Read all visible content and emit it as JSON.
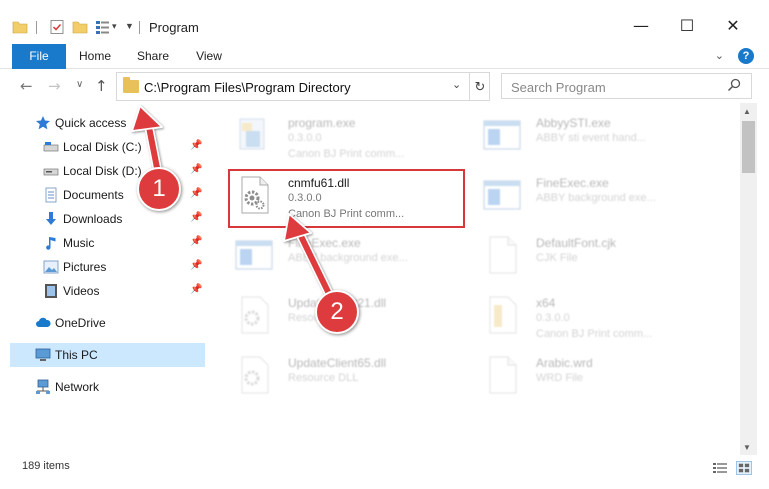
{
  "window": {
    "title": "Program",
    "minimize_glyph": "—",
    "maximize_glyph": "☐",
    "close_glyph": "✕"
  },
  "ribbon": {
    "tabs": [
      {
        "label": "File"
      },
      {
        "label": "Home"
      },
      {
        "label": "Share"
      },
      {
        "label": "View"
      }
    ],
    "help": "?"
  },
  "nav": {
    "address": "C:\\Program Files\\Program Directory",
    "search_placeholder": "Search Program"
  },
  "sidebar": {
    "items": [
      {
        "label": "Quick access",
        "icon": "star-icon",
        "pinned": false
      },
      {
        "label": "Local Disk (C:)",
        "icon": "drive-icon",
        "pinned": true
      },
      {
        "label": "Local Disk (D:)",
        "icon": "drive-icon",
        "pinned": true
      },
      {
        "label": "Documents",
        "icon": "documents-icon",
        "pinned": true
      },
      {
        "label": "Downloads",
        "icon": "download-icon",
        "pinned": true
      },
      {
        "label": "Music",
        "icon": "music-icon",
        "pinned": true
      },
      {
        "label": "Pictures",
        "icon": "pictures-icon",
        "pinned": true
      },
      {
        "label": "Videos",
        "icon": "videos-icon",
        "pinned": true
      },
      {
        "label": "OneDrive",
        "icon": "cloud-icon",
        "pinned": false
      },
      {
        "label": "This PC",
        "icon": "computer-icon",
        "pinned": false,
        "selected": true
      },
      {
        "label": "Network",
        "icon": "network-icon",
        "pinned": false
      }
    ]
  },
  "files": [
    {
      "name": "program.exe",
      "line2": "0.3.0.0",
      "line3": "Canon BJ Print comm...",
      "icon": "program-icon",
      "faded": true
    },
    {
      "name": "AbbyySTI.exe",
      "line2": "ABBY sti event hand...",
      "line3": "",
      "icon": "window-icon",
      "faded": true
    },
    {
      "name": "cnmfu61.dll",
      "line2": "0.3.0.0",
      "line3": "Canon BJ Print comm...",
      "icon": "gear-file-icon",
      "faded": false
    },
    {
      "name": "FineExec.exe",
      "line2": "ABBY background exe...",
      "line3": "",
      "icon": "window-icon",
      "faded": true
    },
    {
      "name": "FineExec.exe",
      "line2": "ABBY background exe...",
      "line3": "",
      "icon": "window-icon",
      "faded": true
    },
    {
      "name": "DefaultFont.cjk",
      "line2": "CJK File",
      "line3": "",
      "icon": "blank-file-icon",
      "faded": true
    },
    {
      "name": "UpdateClient21.dll",
      "line2": "Resource DLL",
      "line3": "",
      "icon": "gear-file-icon",
      "faded": true
    },
    {
      "name": "x64",
      "line2": "0.3.0.0",
      "line3": "Canon BJ Print comm...",
      "icon": "folder-file-icon",
      "faded": true
    },
    {
      "name": "UpdateClient65.dll",
      "line2": "Resource DLL",
      "line3": "",
      "icon": "gear-file-icon",
      "faded": true
    },
    {
      "name": "Arabic.wrd",
      "line2": "WRD File",
      "line3": "",
      "icon": "blank-file-icon",
      "faded": true
    }
  ],
  "status": {
    "items_count": "189 items"
  },
  "callouts": [
    "1",
    "2"
  ],
  "colors": {
    "accent": "#1979ca",
    "selection": "#cce8ff",
    "annotation_red": "#dd3b3d"
  }
}
